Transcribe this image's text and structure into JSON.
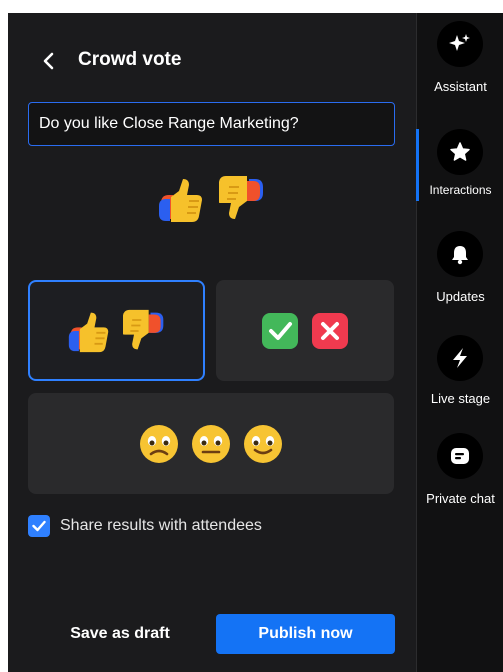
{
  "header": {
    "title": "Crowd vote"
  },
  "question": {
    "value": "Do you like Close Range Marketing?"
  },
  "options": [
    {
      "name": "thumbs",
      "selected": true
    },
    {
      "name": "check-cross",
      "selected": false
    },
    {
      "name": "faces",
      "selected": false
    }
  ],
  "share": {
    "label": "Share results with attendees",
    "checked": true
  },
  "footer": {
    "draft_label": "Save as draft",
    "publish_label": "Publish now"
  },
  "rail": {
    "items": [
      {
        "label": "Assistant",
        "icon": "sparkle-icon"
      },
      {
        "label": "Interactions",
        "icon": "star-icon",
        "active": true
      },
      {
        "label": "Updates",
        "icon": "bell-icon"
      },
      {
        "label": "Live stage",
        "icon": "bolt-icon"
      },
      {
        "label": "Private chat",
        "icon": "chat-icon"
      }
    ]
  },
  "colors": {
    "accent": "#1473f5",
    "panel": "#1b1b1d",
    "rail": "#111112"
  }
}
